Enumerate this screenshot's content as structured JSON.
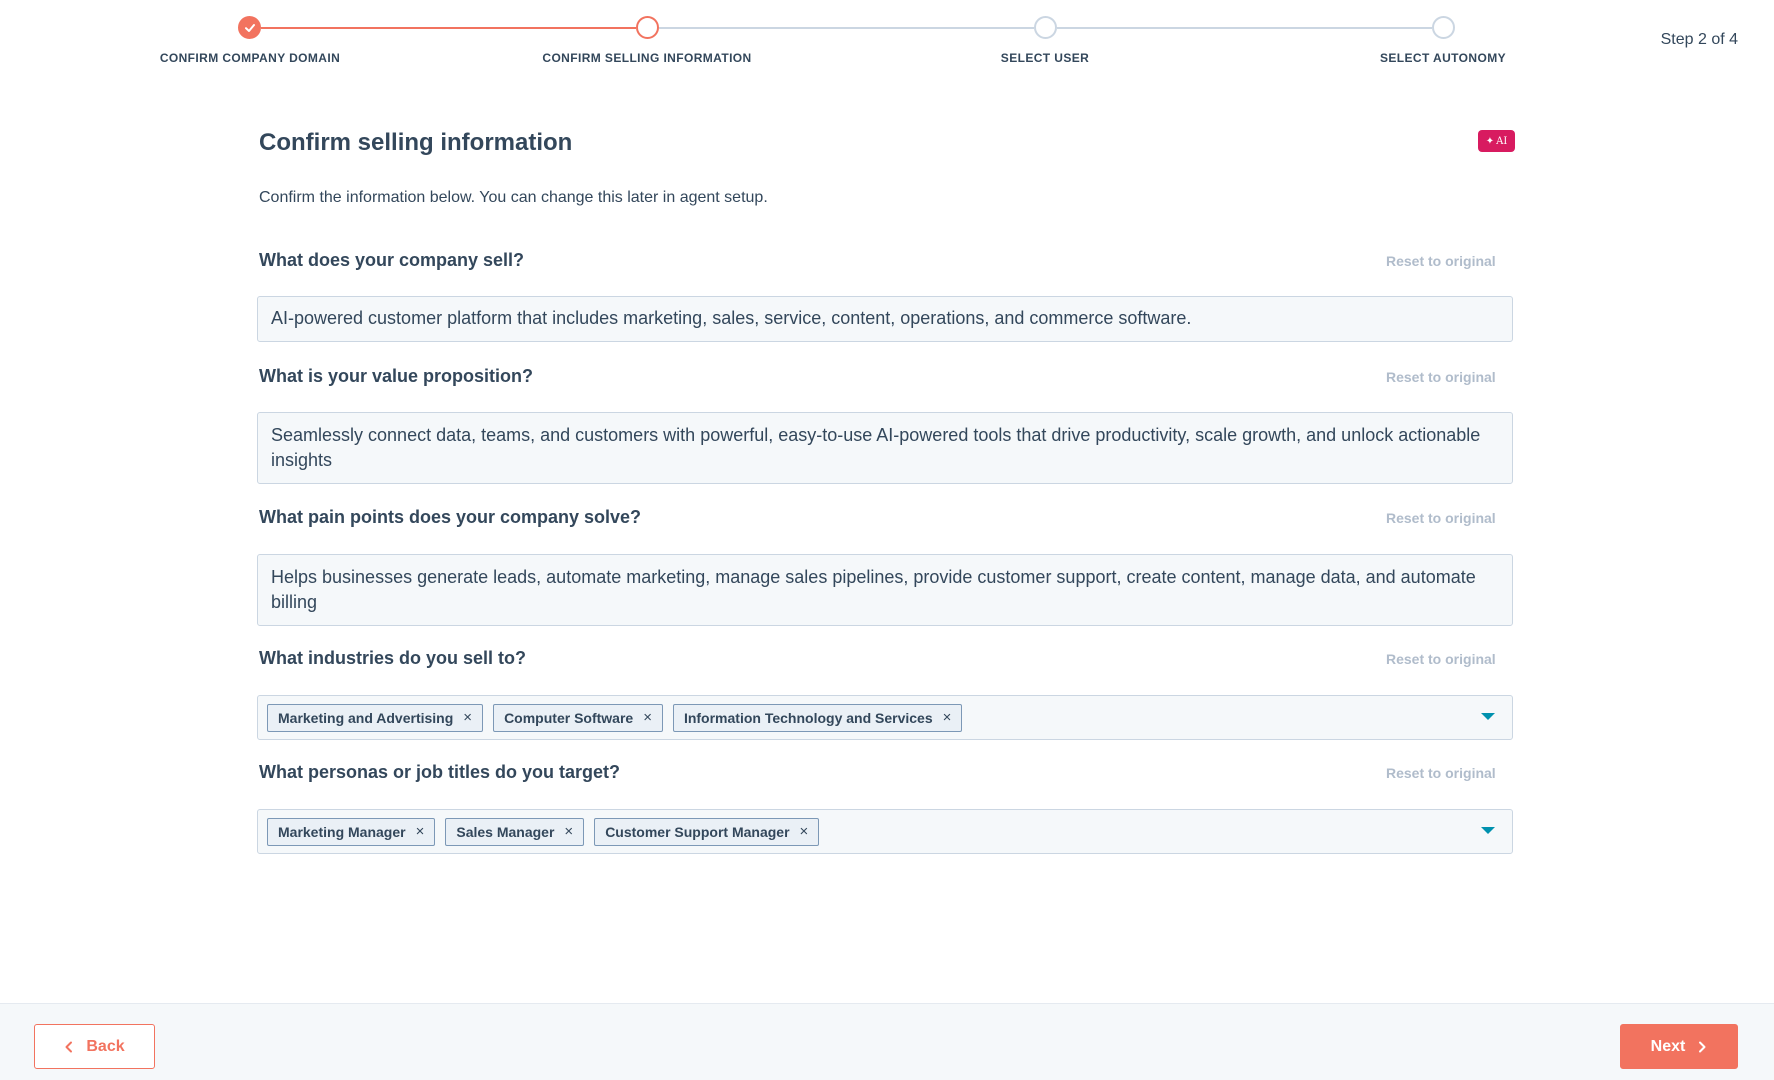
{
  "stepper": {
    "steps": [
      {
        "label": "CONFIRM COMPANY DOMAIN",
        "state": "done"
      },
      {
        "label": "CONFIRM SELLING INFORMATION",
        "state": "active"
      },
      {
        "label": "SELECT USER",
        "state": "todo"
      },
      {
        "label": "SELECT AUTONOMY",
        "state": "todo"
      }
    ],
    "step_count": "Step 2 of 4"
  },
  "page": {
    "title": "Confirm selling information",
    "ai_badge": "AI",
    "intro": "Confirm the information below. You can change this later in agent setup."
  },
  "questions": [
    {
      "label": "What does your company sell?",
      "reset": "Reset to original",
      "value": "AI-powered customer platform that includes marketing, sales, service, content, operations, and commerce software."
    },
    {
      "label": "What is your value proposition?",
      "reset": "Reset to original",
      "value": "Seamlessly connect data, teams, and customers with powerful, easy-to-use AI-powered tools that drive productivity, scale growth, and unlock actionable insights"
    },
    {
      "label": "What pain points does your company solve?",
      "reset": "Reset to original",
      "value": "Helps businesses generate leads, automate marketing, manage sales pipelines, provide customer support, create content, manage data, and automate billing"
    },
    {
      "label": "What industries do you sell to?",
      "reset": "Reset to original",
      "tags": [
        "Marketing and Advertising",
        "Computer Software",
        "Information Technology and Services"
      ]
    },
    {
      "label": "What personas or job titles do you target?",
      "reset": "Reset to original",
      "tags": [
        "Marketing Manager",
        "Sales Manager",
        "Customer Support Manager"
      ]
    }
  ],
  "tag_remove_glyph": "×",
  "footer": {
    "back_label": "Back",
    "next_label": "Next"
  },
  "colors": {
    "accent": "#f2735f",
    "ai_badge": "#d81b60",
    "caret": "#0091ae",
    "text": "#33475b"
  }
}
